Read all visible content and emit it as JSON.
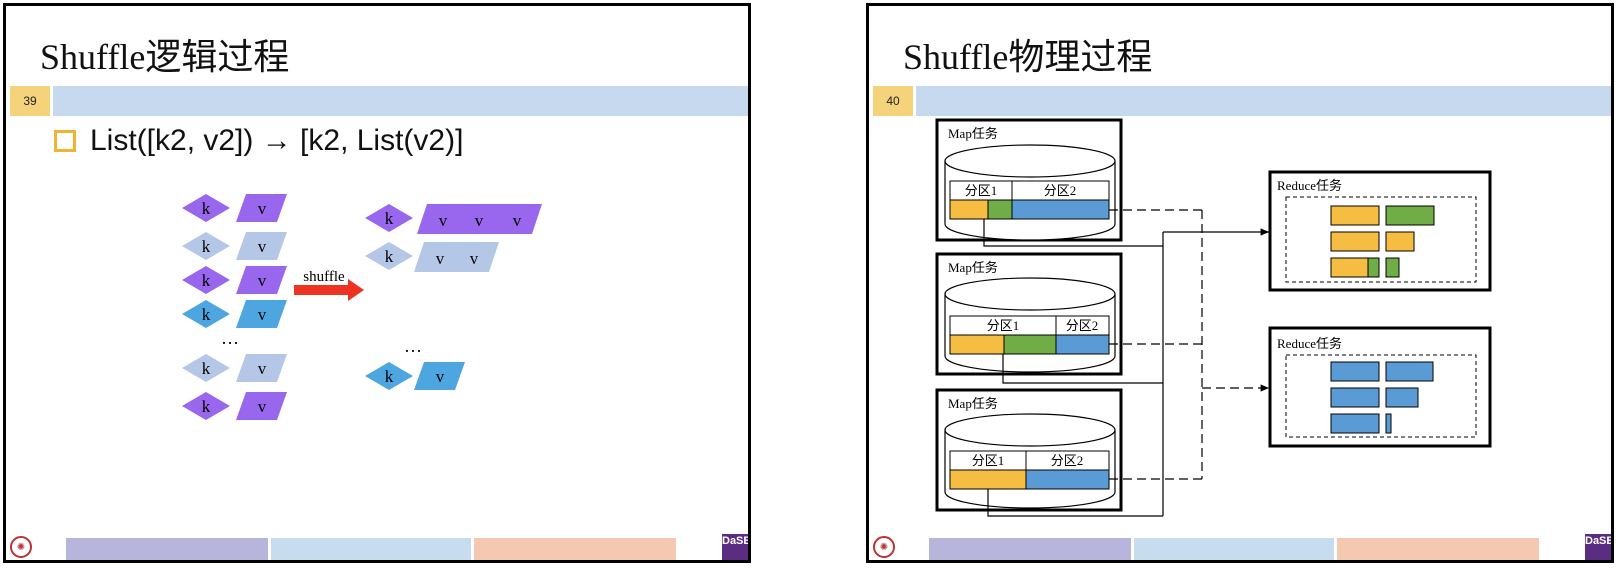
{
  "left_slide": {
    "title": "Shuffle逻辑过程",
    "page_number": "39",
    "bullet": "List([k2, v2]) → [k2, List(v2)]",
    "key_label": "k",
    "value_label": "v",
    "arrow_label": "shuffle",
    "ellipsis": "…"
  },
  "right_slide": {
    "title": "Shuffle物理过程",
    "page_number": "40",
    "map_task_label": "Map任务",
    "reduce_task_label": "Reduce任务",
    "partition1_label": "分区1",
    "partition2_label": "分区2"
  },
  "colors": {
    "purple": "#9966ee",
    "light_blue_gray": "#b5c7e6",
    "sky_blue": "#4da6e0",
    "arrow_red": "#ee3322",
    "yellow": "#f5be42",
    "green": "#70ad47",
    "blue": "#5b9bd5",
    "band_blue": "#c6d9ee",
    "page_yellow": "#f5d37a"
  },
  "logos": {
    "seal": "university-seal-icon",
    "dase": "DaSE"
  }
}
